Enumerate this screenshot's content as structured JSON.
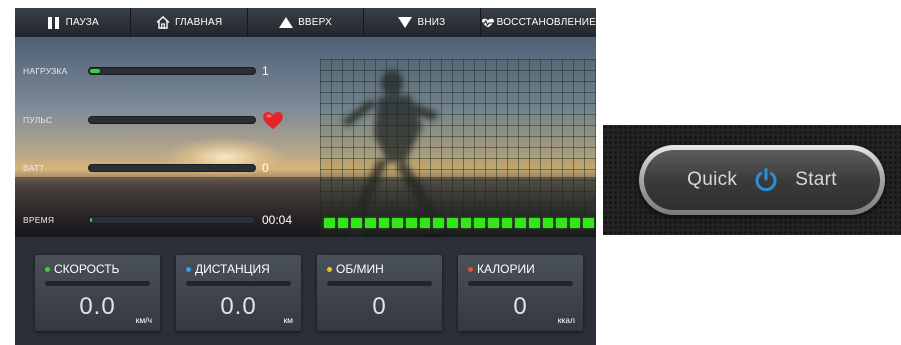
{
  "toolbar": {
    "pause_label": "ПАУЗА",
    "home_label": "ГЛАВНАЯ",
    "up_label": "ВВЕРХ",
    "down_label": "ВНИЗ",
    "recovery_label": "ВОССТАНОВЛЕНИЕ"
  },
  "metrics": {
    "load": {
      "label": "НАГРУЗКА",
      "value": "1",
      "level": 0.06
    },
    "pulse": {
      "label": "ПУЛЬС",
      "level": 0
    },
    "watt": {
      "label": "ВАТТ",
      "value": "0",
      "level": 0
    },
    "time": {
      "label": "ВРЕМЯ",
      "value": "00:04",
      "level": 0.01
    }
  },
  "level_bars": {
    "count": 20,
    "color": "#33e51b"
  },
  "cards": {
    "speed": {
      "title": "СКОРОСТЬ",
      "value": "0.0",
      "unit": "км/ч",
      "dot_color": "#3ad13a"
    },
    "distance": {
      "title": "ДИСТАНЦИЯ",
      "value": "0.0",
      "unit": "км",
      "dot_color": "#2aa7e0"
    },
    "rpm": {
      "title": "ОБ/МИН",
      "value": "0",
      "unit": "",
      "dot_color": "#f2c318"
    },
    "calories": {
      "title": "КАЛОРИИ",
      "value": "0",
      "unit": "ккал",
      "dot_color": "#e8502a"
    }
  },
  "quick_start": {
    "left_text": "Quick",
    "right_text": "Start",
    "icon": "power-icon",
    "icon_color": "#2b8fd8"
  },
  "colors": {
    "accent_green": "#3ad13a",
    "heart_red": "#e2262c"
  }
}
